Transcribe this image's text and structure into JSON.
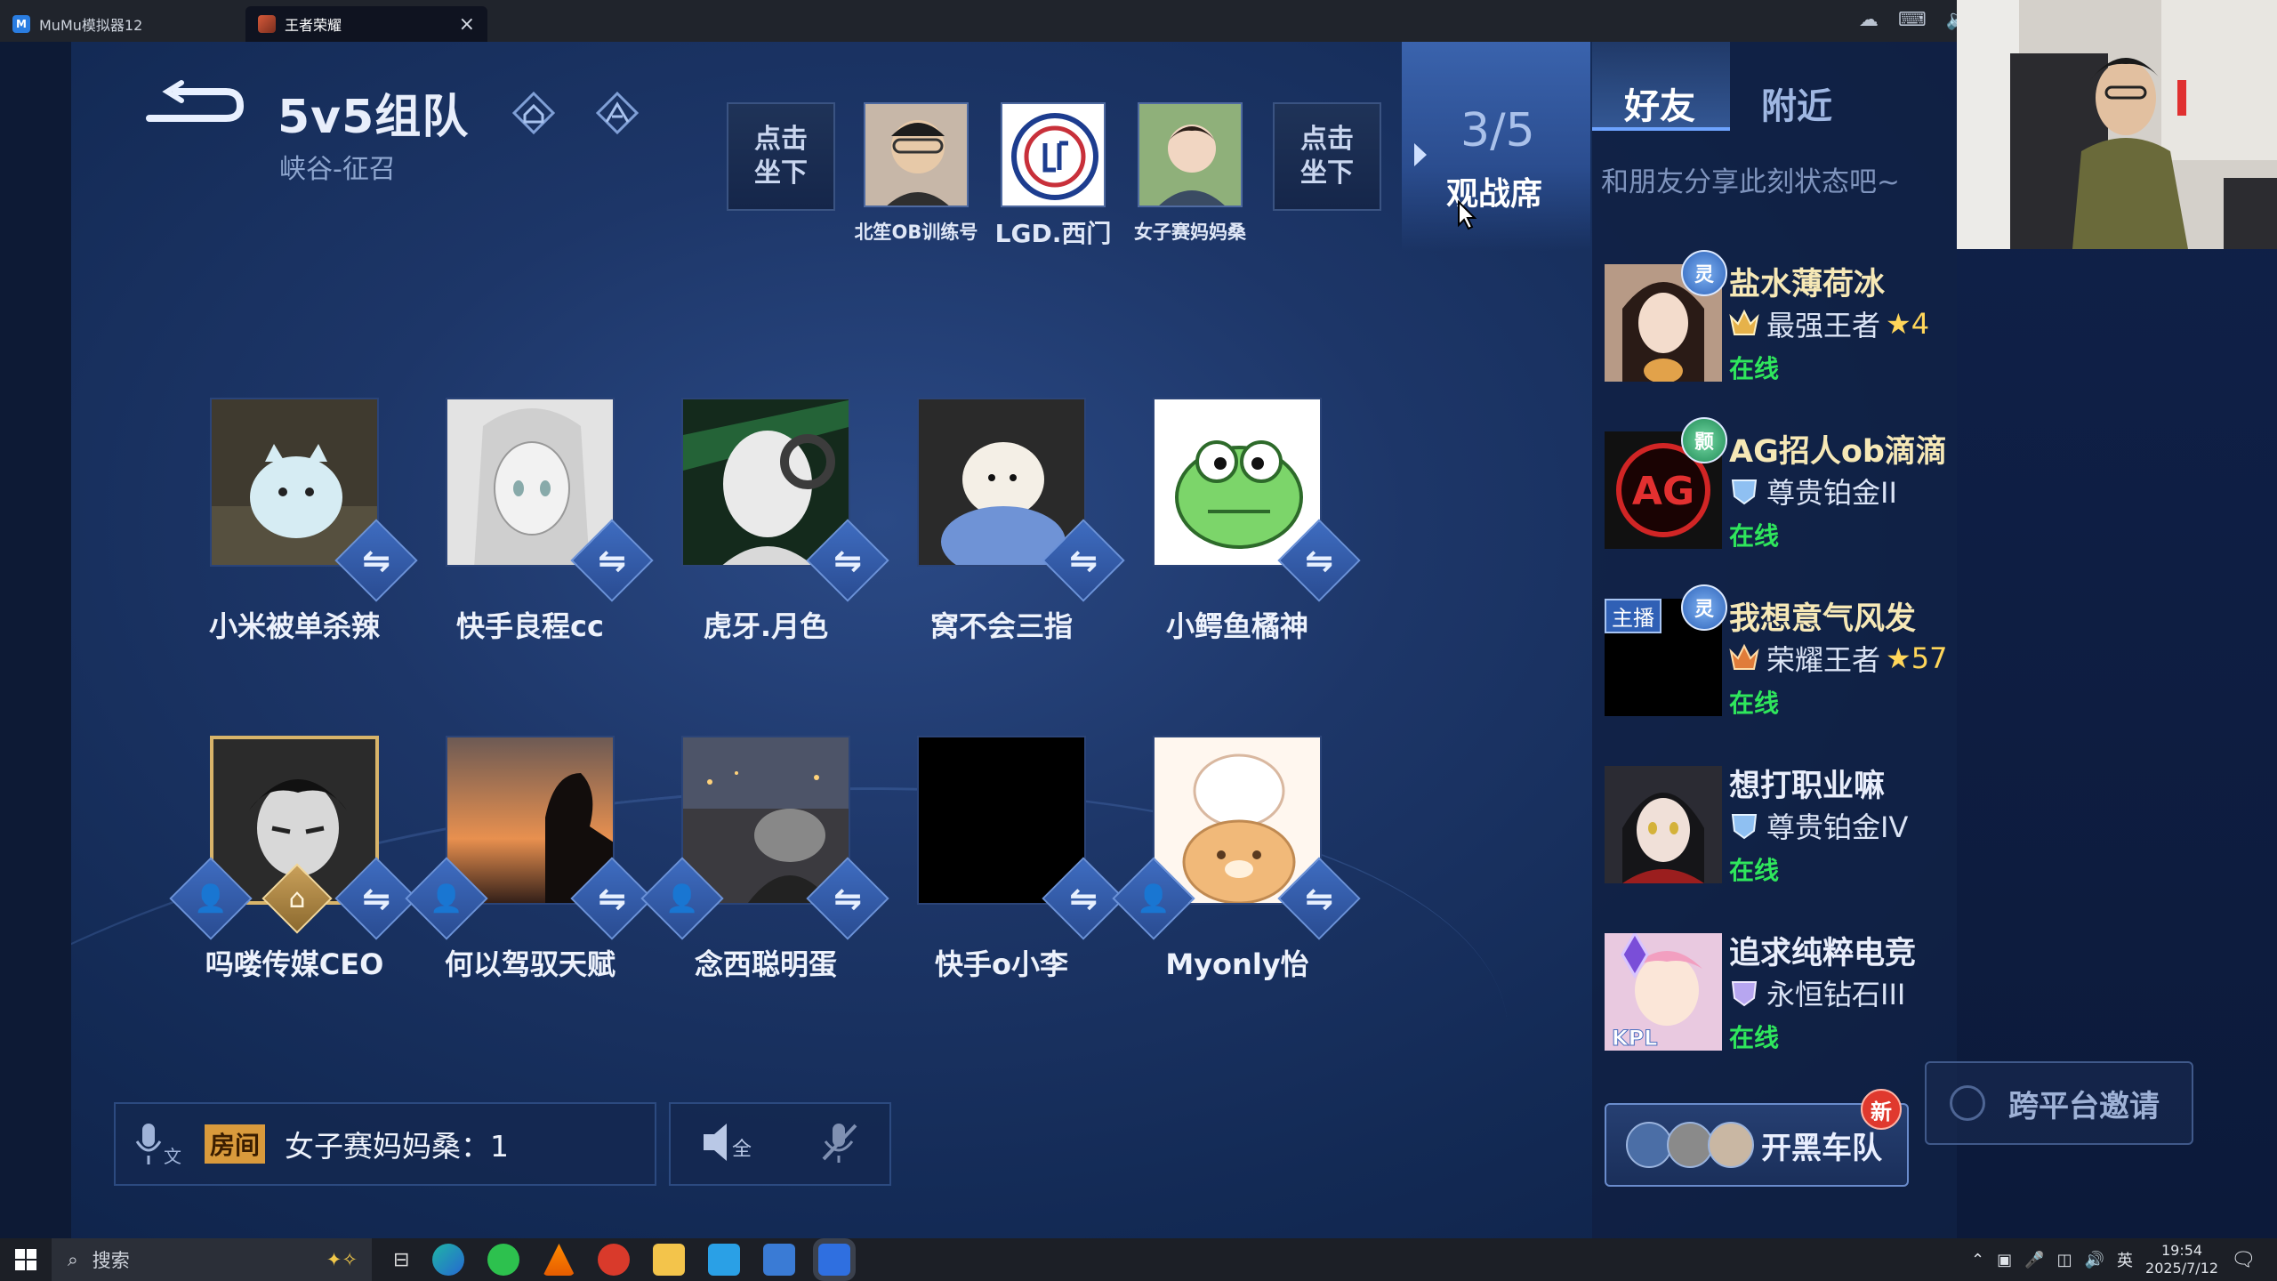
{
  "titlebar": {
    "tabs": [
      {
        "label": "MuMu模拟器12"
      },
      {
        "label": "王者荣耀"
      }
    ]
  },
  "lobby": {
    "title": "5v5组队",
    "subtitle": "峡谷-征召",
    "sit_down_label": "点击\n坐下",
    "top_players": [
      {
        "name": "北笙OB训练号"
      },
      {
        "name": "LGD.西门"
      },
      {
        "name": "女子赛妈妈桑"
      }
    ],
    "spectate": {
      "count": "3/5",
      "label": "观战席"
    }
  },
  "players": [
    {
      "name": "小米被单杀辣"
    },
    {
      "name": "快手良程cc"
    },
    {
      "name": "虎牙.月色"
    },
    {
      "name": "窝不会三指"
    },
    {
      "name": "小鳄鱼橘神"
    },
    {
      "name": "吗喽传媒CEO"
    },
    {
      "name": "何以驾驭天赋"
    },
    {
      "name": "念西聪明蛋"
    },
    {
      "name": "快手o小李"
    },
    {
      "name": "Myonly怡"
    }
  ],
  "voice_bar": {
    "room_tag": "房间",
    "room_text": "女子赛妈妈桑：1"
  },
  "friends_panel": {
    "tabs": [
      {
        "label": "好友"
      },
      {
        "label": "附近"
      }
    ],
    "share_placeholder": "和朋友分享此刻状态吧~",
    "invite_label": "邀请",
    "friends": [
      {
        "name": "盐水薄荷冰",
        "rank": "最强王者",
        "stars": "★4",
        "status": "在线",
        "badge": "灵"
      },
      {
        "name": "AG招人ob滴滴",
        "rank": "尊贵铂金II",
        "stars": "",
        "status": "在线",
        "badge": "颢"
      },
      {
        "name": "我想意气风发",
        "rank": "荣耀王者",
        "stars": "★57",
        "status": "在线",
        "badge": "灵",
        "anchor_tag": "主播"
      },
      {
        "name": "想打职业嘛",
        "rank": "尊贵铂金IV",
        "stars": "",
        "status": "在线"
      },
      {
        "name": "追求纯粹电竞",
        "rank": "永恒钻石III",
        "stars": "",
        "status": "在线",
        "kpl": "KPL"
      }
    ],
    "squad_button": "开黑车队",
    "new_badge": "新",
    "cross_platform_button": "跨平台邀请"
  },
  "taskbar": {
    "search_placeholder": "搜索",
    "ime": "英",
    "time": "19:54",
    "date": "2025/7/12"
  },
  "colors": {
    "online": "#2fe65c",
    "accent": "#3b6ab5",
    "rank_gold": "#f6e8b6"
  }
}
